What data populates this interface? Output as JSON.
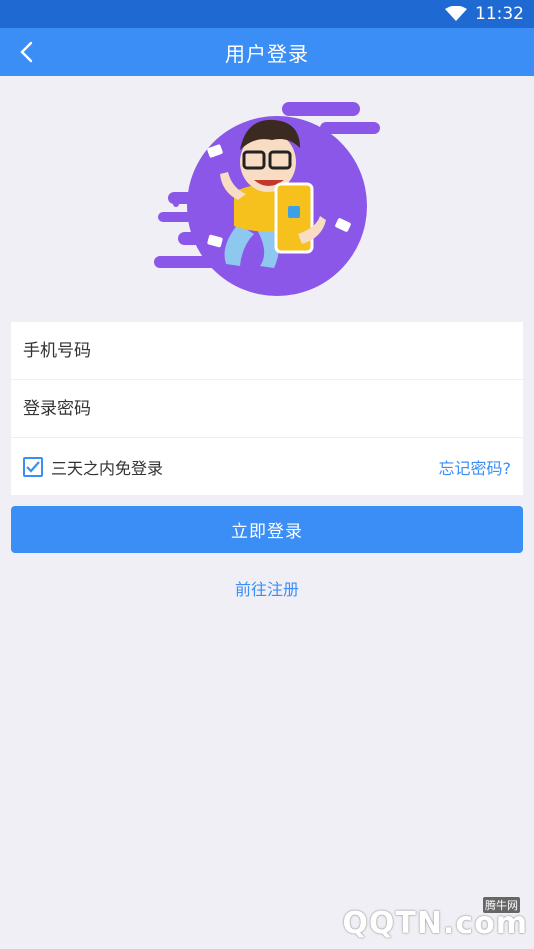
{
  "status_bar": {
    "time": "11:32",
    "icons": [
      "wifi-icon"
    ]
  },
  "navbar": {
    "title": "用户登录",
    "back_icon": "chevron-left-icon"
  },
  "form": {
    "phone_placeholder": "手机号码",
    "password_placeholder": "登录密码",
    "remember_label": "三天之内免登录",
    "remember_checked": true,
    "forgot_label": "忘记密码?"
  },
  "login_button": "立即登录",
  "register_link": "前往注册",
  "watermark": {
    "brand": "QQTN.com",
    "cn": "腾牛网"
  },
  "colors": {
    "primary": "#3b8ef6",
    "status_bar": "#1e69d2",
    "background": "#f0eff5",
    "hero_purple": "#8b57e8",
    "shirt_yellow": "#f6c11d"
  }
}
